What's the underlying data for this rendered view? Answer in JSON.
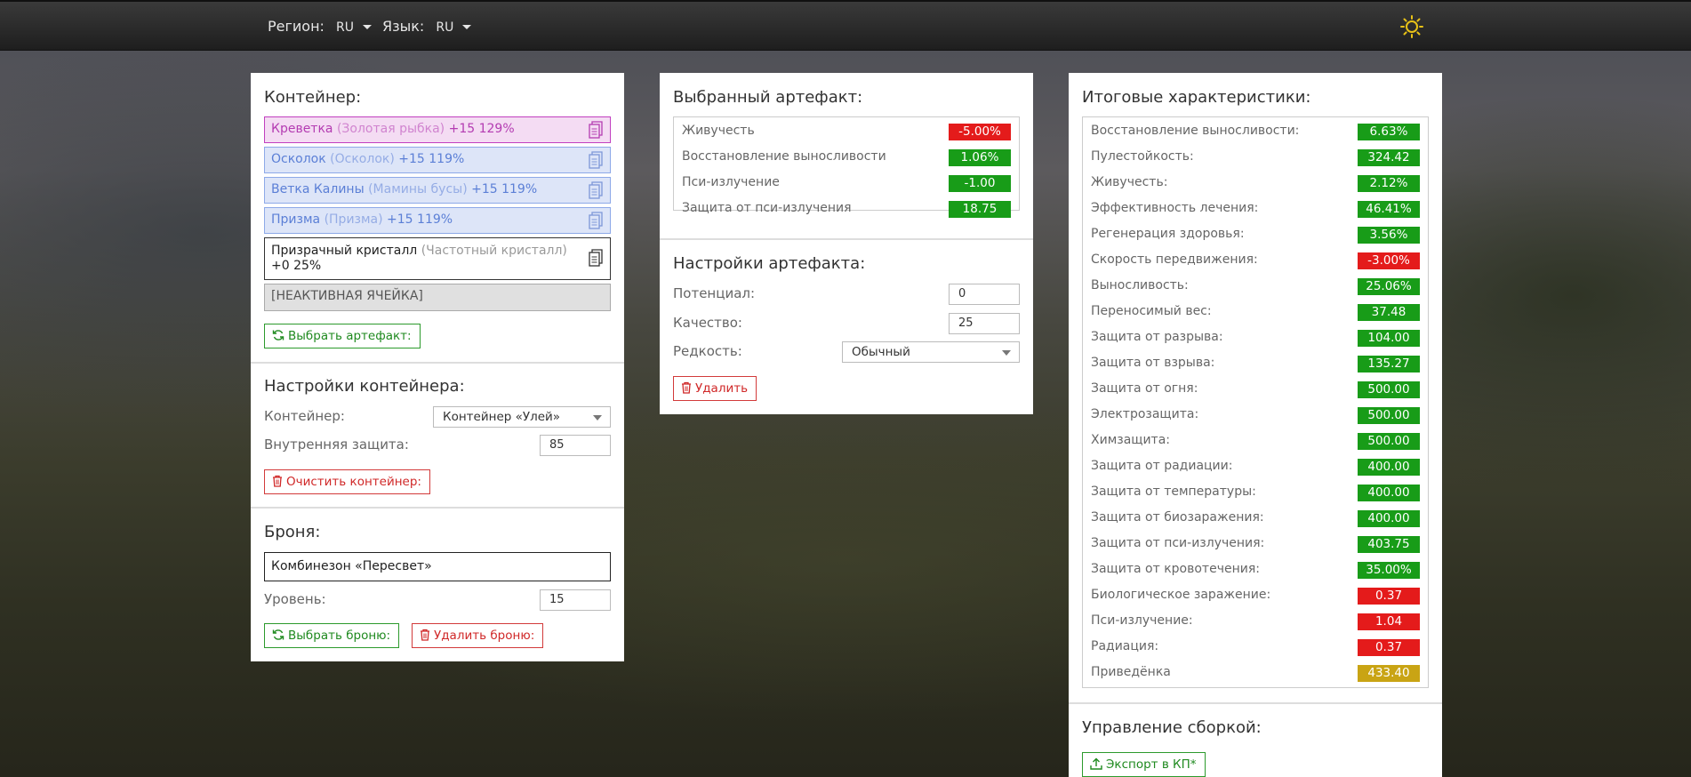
{
  "header": {
    "region_label": "Регион:",
    "region_value": "RU",
    "language_label": "Язык:",
    "language_value": "RU"
  },
  "container_panel": {
    "title": "Контейнер:",
    "slots": [
      {
        "name": "Креветка",
        "base": "(Золотая рыбка)",
        "bonus": "+15 129%",
        "style": "pink"
      },
      {
        "name": "Осколок",
        "base": "(Осколок)",
        "bonus": "+15 119%",
        "style": "blue"
      },
      {
        "name": "Ветка Калины",
        "base": "(Мамины бусы)",
        "bonus": "+15 119%",
        "style": "blue"
      },
      {
        "name": "Призма",
        "base": "(Призма)",
        "bonus": "+15 119%",
        "style": "blue"
      },
      {
        "name": "Призрачный кристалл",
        "base": "(Частотный кристалл)",
        "bonus": "+0 25%",
        "style": "white"
      },
      {
        "name": "[НЕАКТИВНАЯ ЯЧЕЙКА]",
        "style": "gray"
      }
    ],
    "choose_artifact_button": "Выбрать артефакт:",
    "settings_title": "Настройки контейнера:",
    "container_label": "Контейнер:",
    "container_value": "Контейнер «Улей»",
    "internal_protection_label": "Внутренняя защита:",
    "internal_protection_value": "85",
    "clear_button": "Очистить контейнер:",
    "armor_title": "Броня:",
    "armor_value": "Комбинезон «Пересвет»",
    "level_label": "Уровень:",
    "level_value": "15",
    "choose_armor_button": "Выбрать броню:",
    "delete_armor_button": "Удалить броню:"
  },
  "artifact_panel": {
    "title": "Выбранный артефакт:",
    "stats": [
      {
        "label": "Живучесть",
        "value": "-5.00%",
        "color": "red"
      },
      {
        "label": "Восстановление выносливости",
        "value": "1.06%",
        "color": "green"
      },
      {
        "label": "Пси-излучение",
        "value": "-1.00",
        "color": "green"
      },
      {
        "label": "Защита от пси-излучения",
        "value": "18.75",
        "color": "green"
      }
    ],
    "settings_title": "Настройки артефакта:",
    "potential_label": "Потенциал:",
    "potential_value": "0",
    "quality_label": "Качество:",
    "quality_value": "25",
    "rarity_label": "Редкость:",
    "rarity_value": "Обычный",
    "delete_button": "Удалить"
  },
  "totals_panel": {
    "title": "Итоговые характеристики:",
    "stats": [
      {
        "label": "Восстановление выносливости:",
        "value": "6.63%",
        "color": "green"
      },
      {
        "label": "Пулестойкость:",
        "value": "324.42",
        "color": "green"
      },
      {
        "label": "Живучесть:",
        "value": "2.12%",
        "color": "green"
      },
      {
        "label": "Эффективность лечения:",
        "value": "46.41%",
        "color": "green"
      },
      {
        "label": "Регенерация здоровья:",
        "value": "3.56%",
        "color": "green"
      },
      {
        "label": "Скорость передвижения:",
        "value": "-3.00%",
        "color": "red"
      },
      {
        "label": "Выносливость:",
        "value": "25.06%",
        "color": "green"
      },
      {
        "label": "Переносимый вес:",
        "value": "37.48",
        "color": "green"
      },
      {
        "label": "Защита от разрыва:",
        "value": "104.00",
        "color": "green"
      },
      {
        "label": "Защита от взрыва:",
        "value": "135.27",
        "color": "green"
      },
      {
        "label": "Защита от огня:",
        "value": "500.00",
        "color": "green"
      },
      {
        "label": "Электрозащита:",
        "value": "500.00",
        "color": "green"
      },
      {
        "label": "Химзащита:",
        "value": "500.00",
        "color": "green"
      },
      {
        "label": "Защита от радиации:",
        "value": "400.00",
        "color": "green"
      },
      {
        "label": "Защита от температуры:",
        "value": "400.00",
        "color": "green"
      },
      {
        "label": "Защита от биозаражения:",
        "value": "400.00",
        "color": "green"
      },
      {
        "label": "Защита от пси-излучения:",
        "value": "403.75",
        "color": "green"
      },
      {
        "label": "Защита от кровотечения:",
        "value": "35.00%",
        "color": "green"
      },
      {
        "label": "Биологическое заражение:",
        "value": "0.37",
        "color": "red"
      },
      {
        "label": "Пси-излучение:",
        "value": "1.04",
        "color": "red"
      },
      {
        "label": "Радиация:",
        "value": "0.37",
        "color": "red"
      },
      {
        "label": "Приведёнка",
        "value": "433.40",
        "color": "yellow"
      }
    ],
    "build_title": "Управление сборкой:",
    "export_button": "Экспорт в КП*"
  },
  "colors": {
    "green": "#189c18",
    "red": "#e41b1b",
    "yellow": "#c9a414",
    "accent_sun": "#e8c217"
  },
  "icons": [
    "sun-icon",
    "copy-icon",
    "refresh-icon",
    "trash-icon",
    "upload-icon",
    "chevron-down-icon"
  ]
}
